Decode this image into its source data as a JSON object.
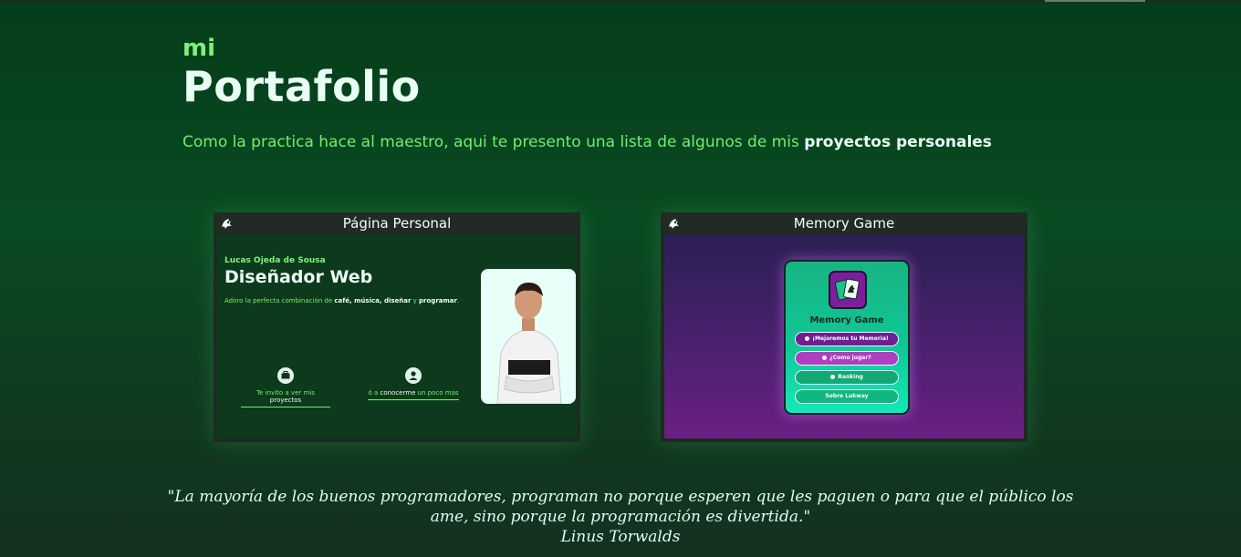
{
  "header": {
    "small_title": "mi",
    "title": "Portafolio",
    "intro_text": "Como la practica hace al maestro, aqui te presento una lista de algunos de mis ",
    "intro_bold": "proyectos personales"
  },
  "projects": [
    {
      "title": "Página Personal",
      "logo_icon": "dragon-logo-icon",
      "preview": {
        "name": "Lucas Ojeda de Sousa",
        "role": "Diseñador Web",
        "desc_prefix": "Adoro la perfecta combinación de ",
        "desc_bold": "café, música, diseñar",
        "desc_mid": " y ",
        "desc_bold2": "programar",
        "desc_end": ".",
        "link1_text": "Te invito a ver mis ",
        "link1_bold": "proyectos",
        "link2_prefix": "ó a ",
        "link2_bold": "conocerme",
        "link2_suffix": " un poco mas"
      }
    },
    {
      "title": "Memory Game",
      "logo_icon": "dragon-logo-icon",
      "preview": {
        "game_title": "Memory Game",
        "buttons": [
          "¡Mejoremos tu Memoria!",
          "¿Como jugar?",
          "Ranking",
          "Sobre Lukway"
        ]
      }
    }
  ],
  "quote": {
    "text": "\"La mayoría de los buenos programadores, programan no porque esperen que les paguen o para que el público los ame, sino porque la programación es divertida.\"",
    "author": "Linus Torwalds"
  },
  "colors": {
    "accent": "#7df27a",
    "background": "#0a4a22",
    "text": "#e9fff5"
  }
}
